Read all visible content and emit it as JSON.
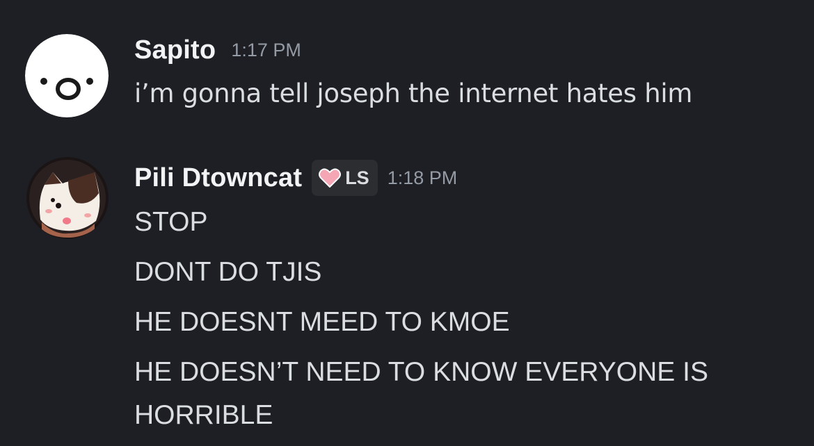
{
  "messages": [
    {
      "username": "Sapito",
      "timestamp": "1:17 PM",
      "avatar_icon": "smiley-face-avatar",
      "lines": [
        "i’m gonna tell joseph the internet hates him"
      ]
    },
    {
      "username": "Pili Dtowncat",
      "tag": {
        "icon": "heart-icon",
        "label": "LS"
      },
      "timestamp": "1:18 PM",
      "avatar_icon": "cat-avatar",
      "lines": [
        "STOP",
        "DONT DO TJIS",
        "HE DOESNT MEED TO KMOE",
        "HE DOESN’T NEED TO KNOW EVERYONE IS",
        "HORRIBLE"
      ]
    }
  ],
  "colors": {
    "background": "#1e1f24",
    "username": "#f2f3f5",
    "timestamp": "#949ba4",
    "message_text": "#dbdee1",
    "tag_background": "#2b2d31",
    "heart": "#f4a6b5"
  }
}
